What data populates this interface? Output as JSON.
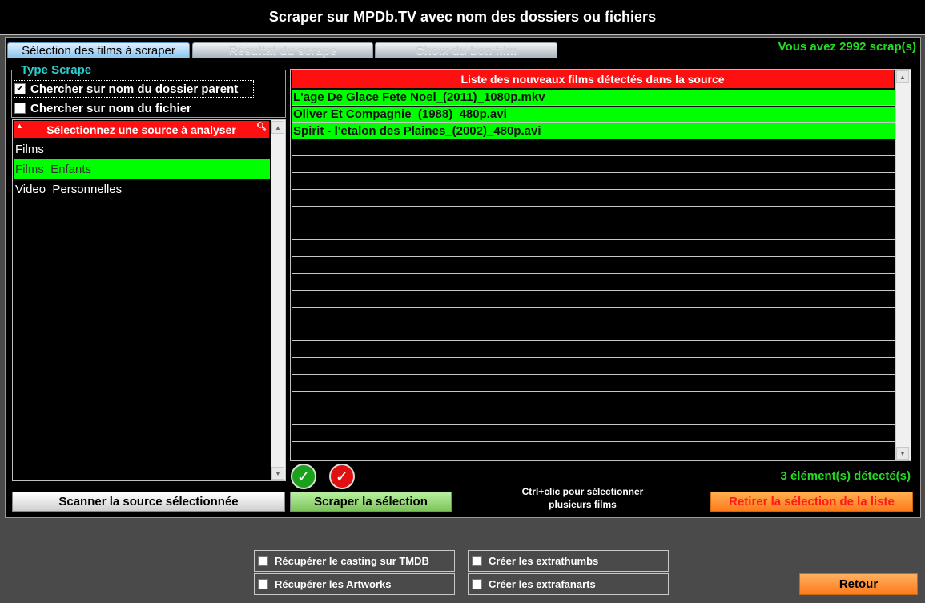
{
  "window": {
    "title": "Scraper sur MPDb.TV avec nom des dossiers ou fichiers"
  },
  "tabs": [
    {
      "label": "Sélection des films à scraper",
      "active": true
    },
    {
      "label": "Résultat du scrape",
      "active": false
    },
    {
      "label": "Choix du bon film",
      "active": false
    }
  ],
  "scrap_count": "Vous avez 2992 scrap(s)",
  "type_scrape": {
    "legend": "Type Scrape",
    "options": [
      {
        "label": "Chercher sur nom du dossier parent",
        "checked": true
      },
      {
        "label": "Chercher sur nom du fichier",
        "checked": false
      }
    ]
  },
  "sources": {
    "header": "Sélectionnez une source à analyser",
    "items": [
      {
        "label": "Films",
        "selected": false
      },
      {
        "label": "Films_Enfants",
        "selected": true
      },
      {
        "label": "Video_Personnelles",
        "selected": false
      }
    ]
  },
  "films": {
    "header": "Liste des nouveaux films détectés dans la source",
    "items": [
      "L'age De Glace Fete Noel_(2011)_1080p.mkv",
      "Oliver Et Compagnie_(1988)_480p.avi",
      "Spirit - l'etalon des Plaines_(2002)_480p.avi"
    ]
  },
  "detected_count": "3 élément(s) détecté(s)",
  "buttons": {
    "scan": "Scanner la source sélectionnée",
    "scrape": "Scraper la sélection",
    "remove": "Retirer la sélection de la liste",
    "back": "Retour"
  },
  "ctrl_hint_line1": "Ctrl+clic pour sélectionner",
  "ctrl_hint_line2": "plusieurs films",
  "options": {
    "casting": "Récupérer le casting sur TMDB",
    "artworks": "Récupérer les Artworks",
    "extrathumbs": "Créer les extrathumbs",
    "extrafanarts": "Créer les extrafanarts"
  },
  "colors": {
    "accent_green": "#00ff00",
    "header_red": "#ff1010",
    "legend_cyan": "#2ad0d0",
    "orange": "#ff7a1a"
  },
  "icons": {
    "select_all": "check-circle-green-icon",
    "deselect": "check-circle-red-icon"
  }
}
